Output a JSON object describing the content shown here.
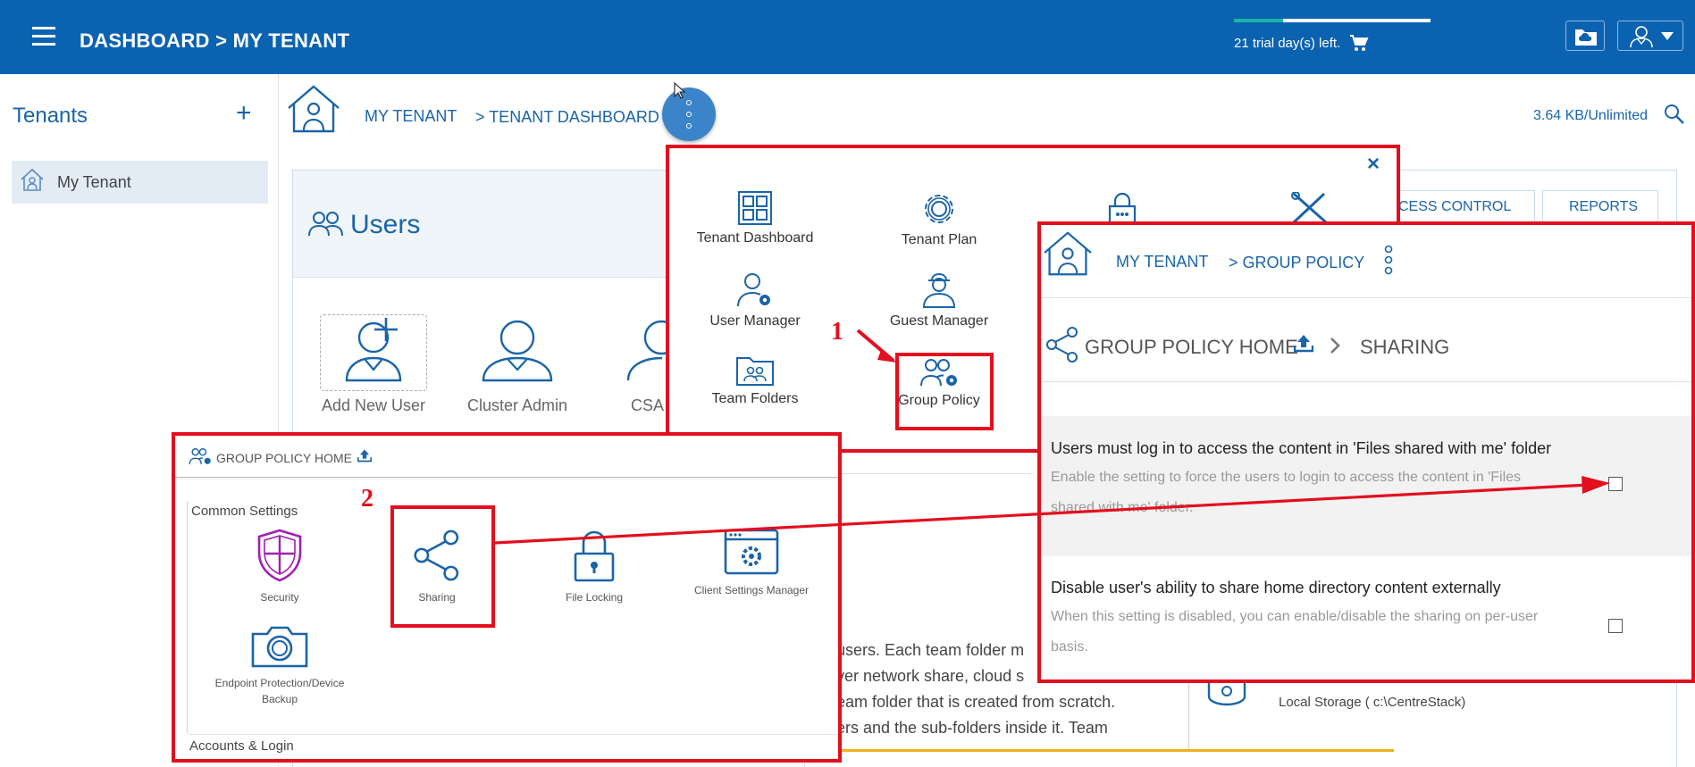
{
  "topbar": {
    "title": "DASHBOARD > MY TENANT",
    "trial_text": "21 trial day(s) left.",
    "trial_progress": 0.25
  },
  "left_panel": {
    "title": "Tenants",
    "add_label": "+",
    "items": [
      {
        "label": "My Tenant"
      }
    ]
  },
  "breadcrumb": {
    "tenant": "MY TENANT",
    "dashboard": "> TENANT DASHBOARD",
    "storage": "3.64 KB/Unlimited"
  },
  "background": {
    "users_title": "Users",
    "tabs": [
      "CESS CONTROL",
      "REPORTS"
    ],
    "tiles": [
      "Add New User",
      "Cluster Admin",
      "CSA"
    ],
    "team_text_lines": [
      "users. Each team folder m",
      "ver network share, cloud s",
      "eam folder that is created from scratch.",
      "ers and the sub-folders inside it. Team"
    ],
    "local_storage": "Local Storage ( c:\\CentreStack)"
  },
  "menu": {
    "close_label": "×",
    "items": [
      {
        "label": "Tenant Dashboard",
        "icon": "grid-icon"
      },
      {
        "label": "Tenant Plan",
        "icon": "gear-icon"
      },
      {
        "label": "User Manager",
        "icon": "user-gear-icon"
      },
      {
        "label": "Guest Manager",
        "icon": "guest-icon"
      },
      {
        "label": "Team Folders",
        "icon": "team-folder-icon"
      },
      {
        "label": "Group Policy",
        "icon": "group-policy-icon"
      }
    ],
    "annotation": "1"
  },
  "group_policy": {
    "crumb_tenant": "MY TENANT",
    "crumb_policy": "> GROUP POLICY",
    "home_label": "GROUP POLICY HOME",
    "sharing_label": "SHARING",
    "settings": [
      {
        "title": "Users must log in to access the content in 'Files shared with me' folder",
        "description": "Enable the setting to force the users to login to access the content in 'Files shared with me' folder.",
        "checked": false
      },
      {
        "title": "Disable user's ability to share home directory content externally",
        "description": "When this setting is disabled, you can enable/disable the sharing on per-user basis.",
        "checked": false
      }
    ]
  },
  "group_policy_home": {
    "title": "GROUP POLICY HOME",
    "section_common": "Common Settings",
    "section_accounts": "Accounts & Login",
    "annotation": "2",
    "items": [
      {
        "label": "Security",
        "icon": "security-shield-icon"
      },
      {
        "label": "Sharing",
        "icon": "share-icon"
      },
      {
        "label": "File Locking",
        "icon": "padlock-icon"
      },
      {
        "label": "Client Settings Manager",
        "icon": "settings-window-icon"
      },
      {
        "label": "Endpoint Protection/Device Backup",
        "icon": "camera-icon"
      }
    ]
  },
  "colors": {
    "brand": "#0b62b1",
    "accent": "#1a64a8",
    "annotation_red": "#e30e1e",
    "security_purple": "#a020b0"
  }
}
